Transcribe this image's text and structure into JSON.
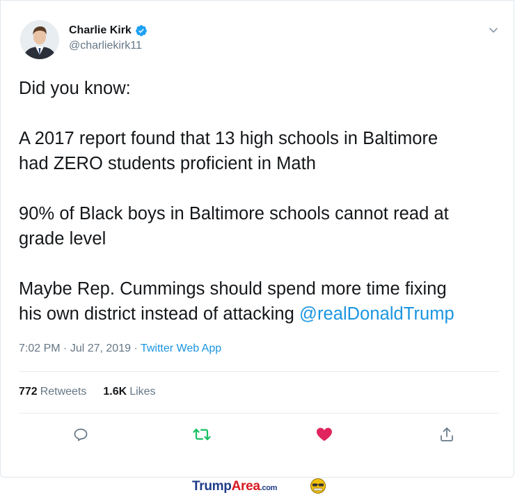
{
  "user": {
    "display_name": "Charlie Kirk",
    "handle": "@charliekirk11",
    "verified_icon": "verified-badge-icon"
  },
  "tweet": {
    "line1": "Did you know:",
    "para2_line1": "A 2017 report found that 13 high schools in Baltimore",
    "para2_line2": "had ZERO students proficient in Math",
    "para3_line1": "90% of Black boys in Baltimore schools cannot read at",
    "para3_line2": "grade level",
    "para4_line1": "Maybe Rep. Cummings should spend more time fixing",
    "para4_line2_text": "his own district instead of attacking ",
    "mention": "@realDonaldTrump"
  },
  "meta": {
    "time": "7:02 PM",
    "separator": " · ",
    "date": "Jul 27, 2019",
    "source": "Twitter Web App"
  },
  "stats": {
    "retweets_count": "772",
    "retweets_label": "Retweets",
    "likes_count": "1.6K",
    "likes_label": "Likes"
  },
  "actions": [
    "reply-icon",
    "retweet-icon",
    "like-icon",
    "share-icon"
  ],
  "colors": {
    "accent": "#1b95e0",
    "retweet": "#17bf63",
    "like": "#e0245e",
    "muted": "#657786"
  },
  "watermark": {
    "trump": "Trump",
    "area": "Area",
    "com": ".com"
  }
}
